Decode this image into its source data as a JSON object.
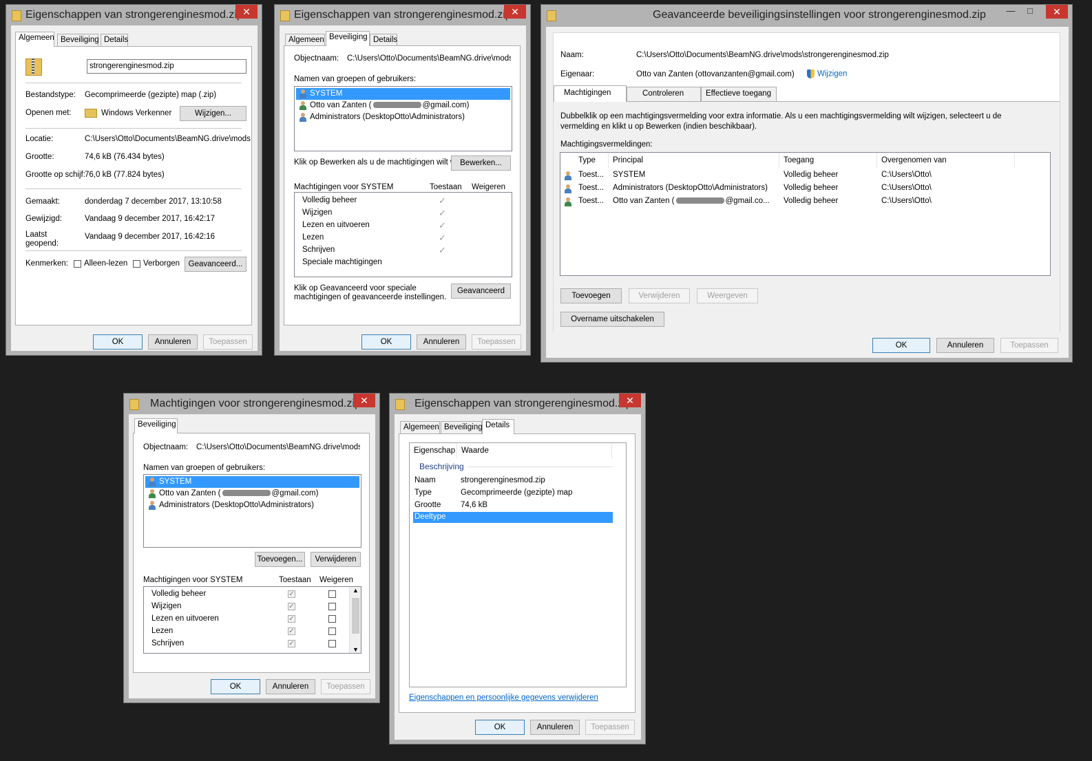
{
  "w1": {
    "title": "Eigenschappen van strongerenginesmod.zip",
    "close": "✕",
    "tabs": [
      "Algemeen",
      "Beveiliging",
      "Details"
    ],
    "filename": "strongerenginesmod.zip",
    "labels": {
      "type": "Bestandstype:",
      "open": "Openen met:",
      "location": "Locatie:",
      "size": "Grootte:",
      "disk": "Grootte op schijf:",
      "created": "Gemaakt:",
      "modified": "Gewijzigd:",
      "opened1": "Laatst",
      "opened2": "geopend:",
      "attrs": "Kenmerken:"
    },
    "values": {
      "type": "Gecomprimeerde (gezipte) map (.zip)",
      "open": "Windows Verkenner",
      "location": "C:\\Users\\Otto\\Documents\\BeamNG.drive\\mods",
      "size": "74,6 kB (76.434 bytes)",
      "disk": "76,0 kB (77.824 bytes)",
      "created": "donderdag 7 december 2017, 13:10:58",
      "modified": "Vandaag 9 december 2017, 16:42:17",
      "opened": "Vandaag 9 december 2017, 16:42:16"
    },
    "change_btn": "Wijzigen...",
    "readonly": "Alleen-lezen",
    "hidden": "Verborgen",
    "advanced_btn": "Geavanceerd...",
    "ok": "OK",
    "cancel": "Annuleren",
    "apply": "Toepassen"
  },
  "w2": {
    "title": "Eigenschappen van strongerenginesmod.zip",
    "close": "✕",
    "tabs": [
      "Algemeen",
      "Beveiliging",
      "Details"
    ],
    "objectname_label": "Objectnaam:",
    "objectname": "C:\\Users\\Otto\\Documents\\BeamNG.drive\\mods\\s",
    "groups_label": "Namen van groepen of gebruikers:",
    "users": [
      "SYSTEM",
      "Otto van Zanten (",
      "@gmail.com)",
      "Administrators (DesktopOtto\\Administrators)"
    ],
    "edit_hint": "Klik op Bewerken als u de machtigingen wilt wijzi",
    "edit_btn": "Bewerken...",
    "perm_label": "Machtigingen voor SYSTEM",
    "allow": "Toestaan",
    "deny": "Weigeren",
    "perms": [
      "Volledig beheer",
      "Wijzigen",
      "Lezen en uitvoeren",
      "Lezen",
      "Schrijven",
      "Speciale machtigingen"
    ],
    "adv_hint1": "Klik op Geavanceerd voor speciale",
    "adv_hint2": "machtigingen of geavanceerde instellingen.",
    "adv_btn": "Geavanceerd",
    "ok": "OK",
    "cancel": "Annuleren",
    "apply": "Toepassen"
  },
  "w3": {
    "title": "Geavanceerde beveiligingsinstellingen voor strongerenginesmod.zip",
    "close": "✕",
    "min": "—",
    "max": "□",
    "name_label": "Naam:",
    "name": "C:\\Users\\Otto\\Documents\\BeamNG.drive\\mods\\strongerenginesmod.zip",
    "owner_label": "Eigenaar:",
    "owner": "Otto van Zanten (ottovanzanten@gmail.com)",
    "owner_change": "Wijzigen",
    "tabs": [
      "Machtigingen",
      "Controleren",
      "Effectieve toegang"
    ],
    "info1": "Dubbelklik op een machtigingsvermelding voor extra informatie. Als u een machtigingsvermelding wilt wijzigen, selecteert u de",
    "info2": "vermelding en klikt u op Bewerken (indien beschikbaar).",
    "entries_label": "Machtigingsvermeldingen:",
    "columns": [
      "Type",
      "Principal",
      "Toegang",
      "Overgenomen van"
    ],
    "rows": [
      {
        "type": "Toest...",
        "principal": "SYSTEM",
        "access": "Volledig beheer",
        "inherited": "C:\\Users\\Otto\\"
      },
      {
        "type": "Toest...",
        "principal": "Administrators (DesktopOtto\\Administrators)",
        "access": "Volledig beheer",
        "inherited": "C:\\Users\\Otto\\"
      },
      {
        "type": "Toest...",
        "principal_a": "Otto van Zanten (",
        "principal_b": "@gmail.co...",
        "access": "Volledig beheer",
        "inherited": "C:\\Users\\Otto\\"
      }
    ],
    "add_btn": "Toevoegen",
    "remove_btn": "Verwijderen",
    "view_btn": "Weergeven",
    "disable_btn": "Overname uitschakelen",
    "ok": "OK",
    "cancel": "Annuleren",
    "apply": "Toepassen"
  },
  "w4": {
    "title": "Machtigingen voor strongerenginesmod.zip",
    "close": "✕",
    "tab": "Beveiliging",
    "objectname_label": "Objectnaam:",
    "objectname": "C:\\Users\\Otto\\Documents\\BeamNG.drive\\mods\\s",
    "groups_label": "Namen van groepen of gebruikers:",
    "users": [
      "SYSTEM",
      "Otto van Zanten (",
      "@gmail.com)",
      "Administrators (DesktopOtto\\Administrators)"
    ],
    "add_btn": "Toevoegen...",
    "remove_btn": "Verwijderen",
    "perm_label": "Machtigingen voor SYSTEM",
    "allow": "Toestaan",
    "deny": "Weigeren",
    "perms": [
      "Volledig beheer",
      "Wijzigen",
      "Lezen en uitvoeren",
      "Lezen",
      "Schrijven"
    ],
    "ok": "OK",
    "cancel": "Annuleren",
    "apply": "Toepassen"
  },
  "w5": {
    "title": "Eigenschappen van strongerenginesmod.zip",
    "close": "✕",
    "tabs": [
      "Algemeen",
      "Beveiliging",
      "Details"
    ],
    "col_prop": "Eigenschap",
    "col_value": "Waarde",
    "group": "Beschrijving",
    "props": [
      {
        "k": "Naam",
        "v": "strongerenginesmod.zip"
      },
      {
        "k": "Type",
        "v": "Gecomprimeerde (gezipte) map"
      },
      {
        "k": "Grootte",
        "v": "74,6 kB"
      }
    ],
    "selected": "Deeltype",
    "remove_link": "Eigenschappen en persoonlijke gegevens verwijderen",
    "ok": "OK",
    "cancel": "Annuleren",
    "apply": "Toepassen"
  }
}
